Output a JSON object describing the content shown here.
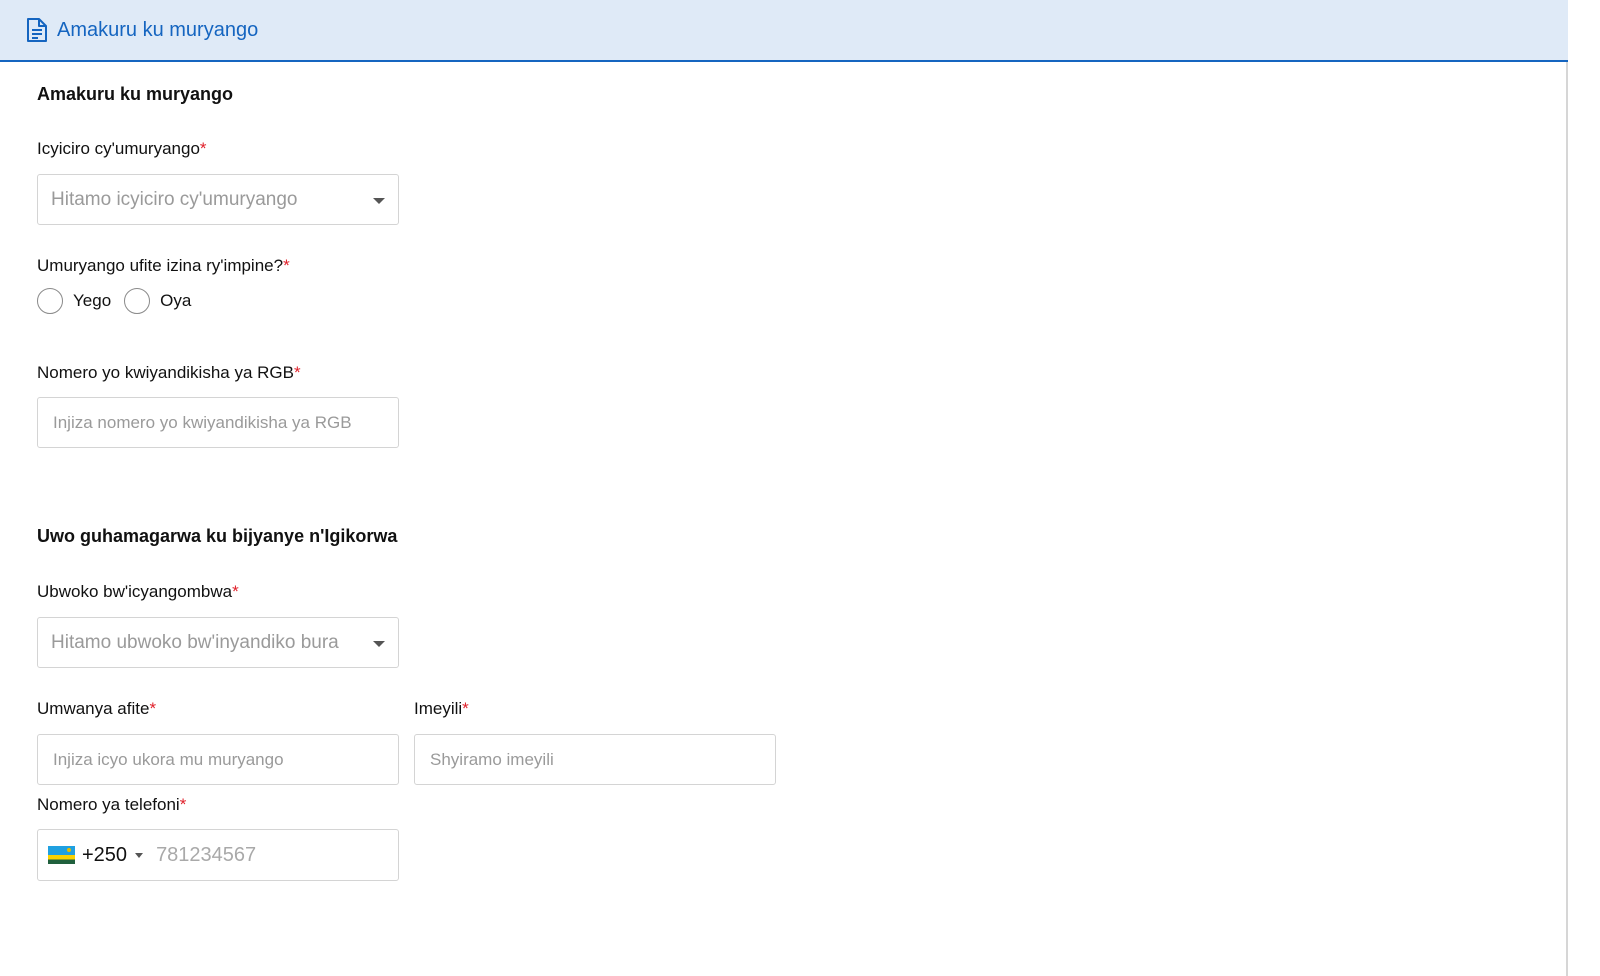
{
  "header": {
    "title": "Amakuru ku muryango",
    "icon": "document-icon",
    "accent": "#1565c0",
    "background": "#dfeaf7"
  },
  "section1": {
    "title": "Amakuru ku muryango",
    "category": {
      "label": "Icyiciro cy'umuryango",
      "required": "*",
      "placeholder": "Hitamo icyiciro cy'umuryango"
    },
    "other_name": {
      "label": "Umuryango ufite izina ry'impine?",
      "required": "*",
      "options": [
        "Yego",
        "Oya"
      ]
    },
    "rgb_number": {
      "label": "Nomero yo kwiyandikisha ya RGB",
      "required": "*",
      "placeholder": "Injiza nomero yo kwiyandikisha ya RGB"
    }
  },
  "section2": {
    "title": "Uwo guhamagarwa ku bijyanye n'Igikorwa",
    "nationality": {
      "label": "Ubwoko bw'icyangombwa",
      "required": "*",
      "placeholder": "Hitamo ubwoko bw'inyandiko bura"
    },
    "position": {
      "label": "Umwanya afite",
      "required": "*",
      "placeholder": "Injiza icyo ukora mu muryango"
    },
    "email": {
      "label": "Imeyili",
      "required": "*",
      "placeholder": "Shyiramo imeyili"
    },
    "phone": {
      "label": "Nomero ya telefoni",
      "required": "*",
      "country_icon": "rwanda-flag-icon",
      "dial_code": "+250",
      "placeholder": "781234567"
    }
  },
  "colors": {
    "required": "#e0202a",
    "placeholder": "#9a9a9a",
    "border": "#d4d4d4"
  }
}
